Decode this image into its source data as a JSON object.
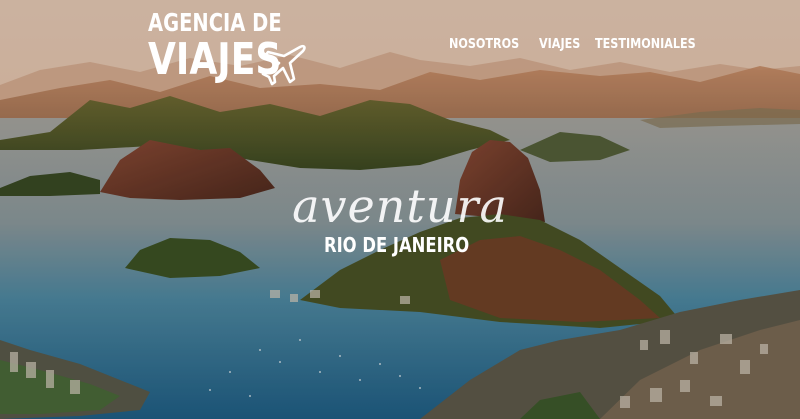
{
  "brand": {
    "line1": "AGENCIA DE",
    "line2": "VIAJES",
    "icon": "airplane-icon"
  },
  "nav": {
    "items": [
      {
        "label": "NOSOTROS"
      },
      {
        "label": "VIAJES"
      },
      {
        "label": "TESTIMONIALES"
      }
    ]
  },
  "hero": {
    "tagline": "aventura",
    "destination": "RIO DE JANEIRO"
  },
  "colors": {
    "text": "#ffffff",
    "sky": "#e8d2bf",
    "sea": "#3f7e98",
    "mountain": "#5f5a2c"
  }
}
